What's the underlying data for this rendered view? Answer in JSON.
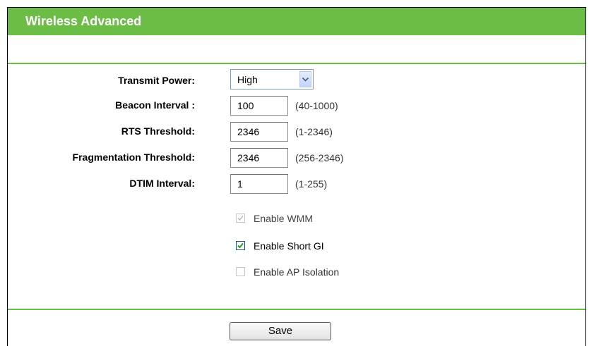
{
  "header": {
    "title": "Wireless Advanced"
  },
  "form": {
    "transmit_power": {
      "label": "Transmit Power:",
      "selected": "High"
    },
    "beacon_interval": {
      "label": "Beacon Interval :",
      "value": "100",
      "hint": "(40-1000)"
    },
    "rts_threshold": {
      "label": "RTS Threshold:",
      "value": "2346",
      "hint": "(1-2346)"
    },
    "fragmentation_threshold": {
      "label": "Fragmentation Threshold:",
      "value": "2346",
      "hint": "(256-2346)"
    },
    "dtim_interval": {
      "label": "DTIM Interval:",
      "value": "1",
      "hint": "(1-255)"
    },
    "checkboxes": [
      {
        "label": "Enable WMM",
        "checked": true,
        "disabled": true
      },
      {
        "label": "Enable Short GI",
        "checked": true,
        "disabled": false
      },
      {
        "label": "Enable AP Isolation",
        "checked": false,
        "disabled": true
      }
    ]
  },
  "actions": {
    "save_label": "Save"
  },
  "colors": {
    "accent": "#6cbd45",
    "title_text": "#ffffff"
  }
}
